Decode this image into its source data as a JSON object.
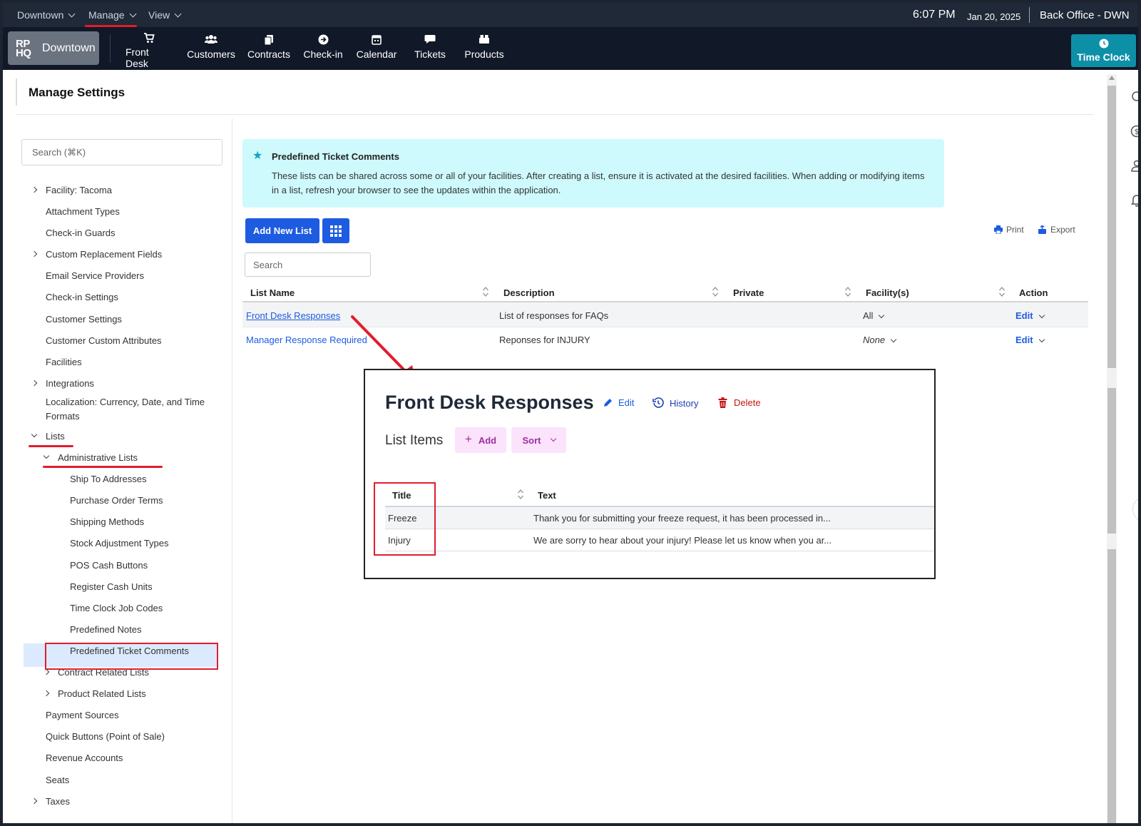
{
  "topbar": {
    "menus": [
      "Downtown",
      "Manage",
      "View"
    ],
    "time": "6:07 PM",
    "date": "Jan 20, 2025",
    "location": "Back Office - DWN"
  },
  "navbar": {
    "logo_mark_top": "RP",
    "logo_mark_bottom": "HQ",
    "logo_text": "Downtown",
    "items": [
      "Front Desk",
      "Customers",
      "Contracts",
      "Check-in",
      "Calendar",
      "Tickets",
      "Products"
    ],
    "time_clock": "Time Clock"
  },
  "page": {
    "title": "Manage Settings"
  },
  "sidebar": {
    "search_placeholder": "Search (⌘K)",
    "items": [
      "Facility: Tacoma",
      "Attachment Types",
      "Check-in Guards",
      "Custom Replacement Fields",
      "Email Service Providers",
      "Check-in Settings",
      "Customer Settings",
      "Customer Custom Attributes",
      "Facilities",
      "Integrations",
      "Localization: Currency, Date, and Time",
      "Formats",
      "Lists",
      "Administrative Lists",
      "Ship To Addresses",
      "Purchase Order Terms",
      "Shipping Methods",
      "Stock Adjustment Types",
      "POS Cash Buttons",
      "Register Cash Units",
      "Time Clock Job Codes",
      "Predefined Notes",
      "Predefined Ticket Comments",
      "Contract Related Lists",
      "Product Related Lists",
      "Payment Sources",
      "Quick Buttons (Point of Sale)",
      "Revenue Accounts",
      "Seats",
      "Taxes"
    ]
  },
  "banner": {
    "title": "Predefined Ticket Comments",
    "text": "These lists can be shared across some or all of your facilities. After creating a list, ensure it is activated at the desired facilities. When adding or modifying items in a list, refresh your browser to see the updates within the application."
  },
  "toolbar": {
    "add_new_list": "Add New List",
    "print": "Print",
    "export": "Export",
    "search_placeholder": "Search"
  },
  "table": {
    "headers": [
      "List Name",
      "Description",
      "Private",
      "Facility(s)",
      "Action"
    ],
    "rows": [
      {
        "name": "Front Desk Responses",
        "description": "List of responses for FAQs",
        "private": "",
        "facility": "All",
        "action": "Edit"
      },
      {
        "name": "Manager Response Required",
        "description": "Reponses for INJURY",
        "private": "",
        "facility": "None",
        "action": "Edit"
      }
    ]
  },
  "popup": {
    "title": "Front Desk Responses",
    "edit": "Edit",
    "history": "History",
    "delete": "Delete",
    "subtitle": "List Items",
    "add": "Add",
    "sort": "Sort",
    "headers": [
      "Title",
      "Text"
    ],
    "rows": [
      {
        "title": "Freeze",
        "text": "Thank you for submitting your freeze request, it has been processed in..."
      },
      {
        "title": "Injury",
        "text": "We are sorry to hear about your injury! Please let us know when you ar..."
      }
    ]
  },
  "colors": {
    "accent": "#1d5be0",
    "highlight": "#e11d2e",
    "banner": "#cefafd",
    "nav": "#111827"
  }
}
